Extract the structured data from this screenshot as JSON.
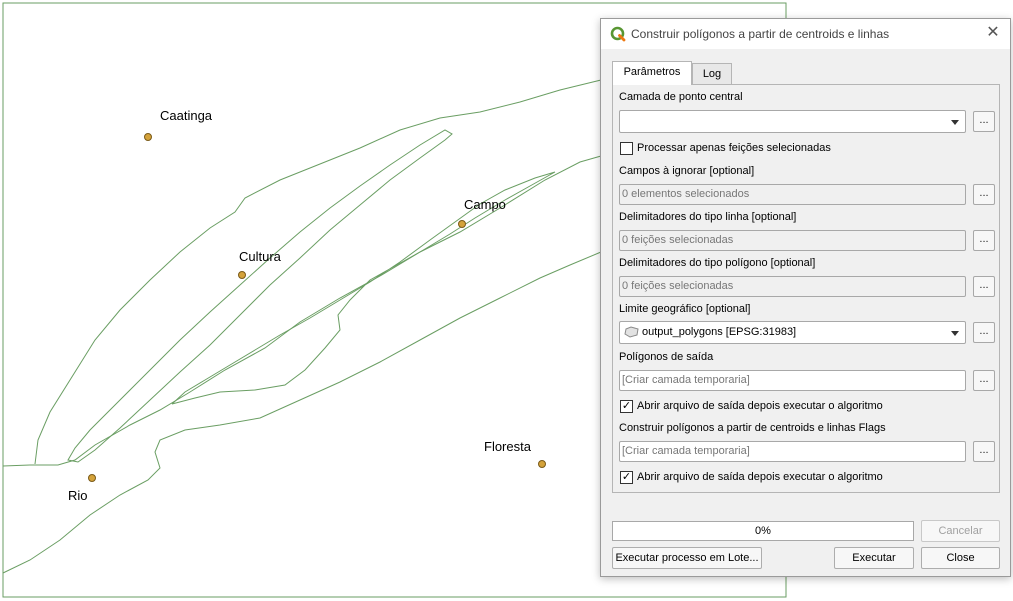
{
  "map": {
    "places": [
      {
        "id": "caatinga",
        "name": "Caatinga"
      },
      {
        "id": "cultura",
        "name": "Cultura"
      },
      {
        "id": "campo",
        "name": "Campo"
      },
      {
        "id": "floresta",
        "name": "Floresta"
      },
      {
        "id": "rio",
        "name": "Rio"
      }
    ],
    "colors": {
      "line": "#6a9e63",
      "point_fill": "#d4a23a",
      "point_stroke": "#7a5a18",
      "frame": "#6a9e63"
    }
  },
  "dialog": {
    "title": "Construir polígonos a partir de centroids e linhas",
    "icon": "qgis-logo-icon",
    "close_icon": "close-icon",
    "tabs": {
      "params": "Parâmetros",
      "log": "Log"
    },
    "params": {
      "center_layer": {
        "label": "Camada de ponto central",
        "value": ""
      },
      "selected_only": {
        "label": "Processar apenas feições selecionadas",
        "checked": false
      },
      "ignore_fields": {
        "label": "Campos à ignorar [optional]",
        "value": "0 elementos selecionados"
      },
      "line_delims": {
        "label": "Delimitadores do tipo linha [optional]",
        "value": "0 feições selecionadas"
      },
      "poly_delims": {
        "label": "Delimitadores do tipo polígono [optional]",
        "value": "0 feições selecionadas"
      },
      "geo_bounds": {
        "label": "Limite geográfico [optional]",
        "value": "output_polygons [EPSG:31983]"
      },
      "output": {
        "label": "Polígonos de saída",
        "placeholder": "[Criar camada temporaria]"
      },
      "open_output1": {
        "label": "Abrir arquivo de saída depois executar o algoritmo",
        "checked": true,
        "mark": "✓"
      },
      "flags": {
        "label": "Construir polígonos a partir de centroids e linhas Flags",
        "placeholder": "[Criar camada temporaria]"
      },
      "open_output2": {
        "label": "Abrir arquivo de saída depois executar o algoritmo",
        "checked": true,
        "mark": "✓"
      },
      "dots_label": "..."
    },
    "progress": {
      "value": 0,
      "text": "0%"
    },
    "buttons": {
      "cancel": "Cancelar",
      "batch": "Executar processo em Lote...",
      "run": "Executar",
      "close": "Close"
    }
  }
}
